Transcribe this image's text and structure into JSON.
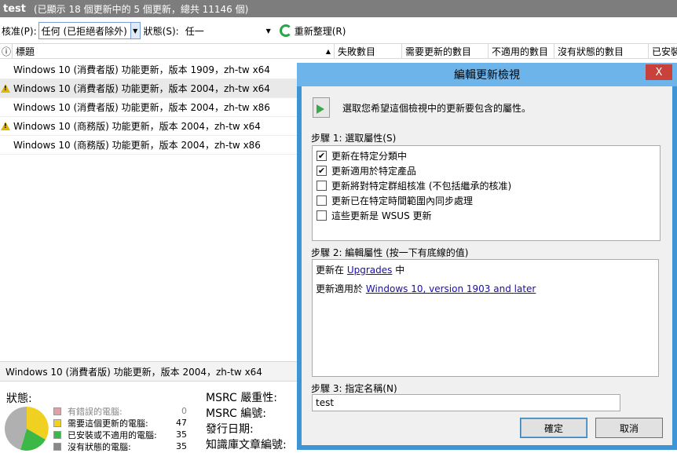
{
  "window": {
    "title": "test",
    "summary": "(已顯示 18 個更新中的 5 個更新，總共 11146 個)"
  },
  "toolbar": {
    "approval_label": "核准(P):",
    "approval_value": "任何 (已拒絕者除外)",
    "status_label": "狀態(S):",
    "status_value": "任一",
    "refresh_label": "重新整理(R)"
  },
  "columns": [
    "標題",
    "失敗數目",
    "需要更新的數目",
    "不適用的數目",
    "沒有狀態的數目",
    "已安裝"
  ],
  "rows": [
    {
      "title": "Windows 10 (消費者版) 功能更新，版本 1909，zh-tw x64",
      "warning": false,
      "selected": false
    },
    {
      "title": "Windows 10 (消費者版) 功能更新，版本 2004，zh-tw x64",
      "warning": true,
      "selected": true
    },
    {
      "title": "Windows 10 (消費者版) 功能更新，版本 2004，zh-tw x86",
      "warning": false,
      "selected": false
    },
    {
      "title": "Windows 10 (商務版) 功能更新，版本 2004，zh-tw x64",
      "warning": true,
      "selected": false
    },
    {
      "title": "Windows 10 (商務版) 功能更新，版本 2004，zh-tw x86",
      "warning": false,
      "selected": false
    }
  ],
  "detail": {
    "title": "Windows 10 (消費者版) 功能更新，版本 2004，zh-tw x64",
    "status_label": "狀態:",
    "legend": [
      {
        "label": "有錯誤的電腦:",
        "value": "0",
        "color": "#e0a0a8"
      },
      {
        "label": "需要這個更新的電腦:",
        "value": "47",
        "color": "#f0d020"
      },
      {
        "label": "已安裝或不適用的電腦:",
        "value": "35",
        "color": "#3cb846"
      },
      {
        "label": "沒有狀態的電腦:",
        "value": "35",
        "color": "#888888"
      }
    ],
    "msrc_severity": "MSRC 嚴重性:",
    "msrc_number": "MSRC 編號:",
    "release_date": "發行日期:",
    "kb_article": "知識庫文章編號:"
  },
  "dialog": {
    "title": "編輯更新檢視",
    "close_label": "X",
    "intro": "選取您希望這個檢視中的更新要包含的屬性。",
    "step1_label": "步驟 1: 選取屬性(S)",
    "properties": [
      {
        "label": "更新在特定分類中",
        "checked": true
      },
      {
        "label": "更新適用於特定產品",
        "checked": true
      },
      {
        "label": "更新將對特定群組核准 (不包括繼承的核准)",
        "checked": false
      },
      {
        "label": "更新已在特定時間範圍內同步處理",
        "checked": false
      },
      {
        "label": "這些更新是 WSUS 更新",
        "checked": false
      }
    ],
    "step2_label": "步驟 2: 編輯屬性 (按一下有底線的值)",
    "line1_prefix": "更新在",
    "line1_link": "Upgrades",
    "line1_suffix": "中",
    "line2_prefix": "更新適用於",
    "line2_link": "Windows 10, version 1903 and later",
    "step3_label": "步驟 3: 指定名稱(N)",
    "name_value": "test",
    "ok_label": "確定",
    "cancel_label": "取消"
  }
}
